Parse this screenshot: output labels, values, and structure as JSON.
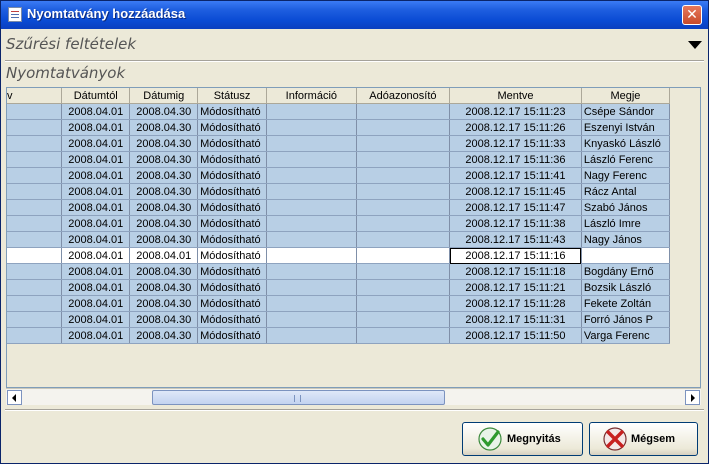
{
  "window": {
    "title": "Nyomtatvány hozzáadása",
    "close_label": "✕"
  },
  "filter": {
    "title": "Szűrési feltételek"
  },
  "forms": {
    "title": "Nyomtatványok"
  },
  "table": {
    "columns": [
      "v",
      "Dátumtól",
      "Dátumig",
      "Státusz",
      "Információ",
      "Adóazonosító",
      "Mentve",
      "Megje"
    ],
    "rows": [
      {
        "first": "",
        "from": "2008.04.01",
        "to": "2008.04.30",
        "status": "Módosítható",
        "info": "",
        "taxid": "",
        "saved": "2008.12.17   15:11:23",
        "note": "Csépe Sándor"
      },
      {
        "first": "",
        "from": "2008.04.01",
        "to": "2008.04.30",
        "status": "Módosítható",
        "info": "",
        "taxid": "",
        "saved": "2008.12.17   15:11:26",
        "note": "Eszenyi István"
      },
      {
        "first": "",
        "from": "2008.04.01",
        "to": "2008.04.30",
        "status": "Módosítható",
        "info": "",
        "taxid": "",
        "saved": "2008.12.17   15:11:33",
        "note": "Knyaskó László"
      },
      {
        "first": "",
        "from": "2008.04.01",
        "to": "2008.04.30",
        "status": "Módosítható",
        "info": "",
        "taxid": "",
        "saved": "2008.12.17   15:11:36",
        "note": "László Ferenc"
      },
      {
        "first": "",
        "from": "2008.04.01",
        "to": "2008.04.30",
        "status": "Módosítható",
        "info": "",
        "taxid": "",
        "saved": "2008.12.17   15:11:41",
        "note": "Nagy Ferenc"
      },
      {
        "first": "",
        "from": "2008.04.01",
        "to": "2008.04.30",
        "status": "Módosítható",
        "info": "",
        "taxid": "",
        "saved": "2008.12.17   15:11:45",
        "note": "Rácz Antal"
      },
      {
        "first": "",
        "from": "2008.04.01",
        "to": "2008.04.30",
        "status": "Módosítható",
        "info": "",
        "taxid": "",
        "saved": "2008.12.17   15:11:47",
        "note": "Szabó János"
      },
      {
        "first": "",
        "from": "2008.04.01",
        "to": "2008.04.30",
        "status": "Módosítható",
        "info": "",
        "taxid": "",
        "saved": "2008.12.17   15:11:38",
        "note": "László Imre"
      },
      {
        "first": "",
        "from": "2008.04.01",
        "to": "2008.04.30",
        "status": "Módosítható",
        "info": "",
        "taxid": "",
        "saved": "2008.12.17   15:11:43",
        "note": "Nagy János"
      },
      {
        "first": "",
        "from": "2008.04.01",
        "to": "2008.04.01",
        "status": "Módosítható",
        "info": "",
        "taxid": "",
        "saved": "2008.12.17   15:11:16",
        "note": ""
      },
      {
        "first": "",
        "from": "2008.04.01",
        "to": "2008.04.30",
        "status": "Módosítható",
        "info": "",
        "taxid": "",
        "saved": "2008.12.17   15:11:18",
        "note": "Bogdány Ernő"
      },
      {
        "first": "",
        "from": "2008.04.01",
        "to": "2008.04.30",
        "status": "Módosítható",
        "info": "",
        "taxid": "",
        "saved": "2008.12.17   15:11:21",
        "note": "Bozsik László"
      },
      {
        "first": "",
        "from": "2008.04.01",
        "to": "2008.04.30",
        "status": "Módosítható",
        "info": "",
        "taxid": "",
        "saved": "2008.12.17   15:11:28",
        "note": "Fekete Zoltán"
      },
      {
        "first": "",
        "from": "2008.04.01",
        "to": "2008.04.30",
        "status": "Módosítható",
        "info": "",
        "taxid": "",
        "saved": "2008.12.17   15:11:31",
        "note": "Forró János P"
      },
      {
        "first": "",
        "from": "2008.04.01",
        "to": "2008.04.30",
        "status": "Módosítható",
        "info": "",
        "taxid": "",
        "saved": "2008.12.17   15:11:50",
        "note": "Varga Ferenc"
      }
    ],
    "highlight_row_index": 9
  },
  "scrollbar": {
    "grip_label": "⦀"
  },
  "buttons": {
    "open_label": "Megnyitás",
    "cancel_label": "Mégsem"
  },
  "colors": {
    "titlebar": "#0a4bd4",
    "row_bg": "#b8cfe5",
    "window_bg": "#ece9d8"
  }
}
